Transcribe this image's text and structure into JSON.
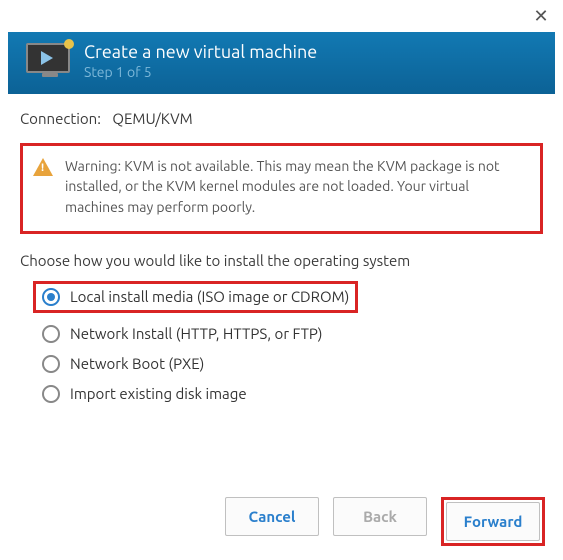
{
  "header": {
    "title": "Create a new virtual machine",
    "step": "Step 1 of 5"
  },
  "connection": {
    "label": "Connection:",
    "value": "QEMU/KVM"
  },
  "warning": {
    "text": "Warning: KVM is not available. This may mean the KVM package is not installed, or the KVM kernel modules are not loaded. Your virtual machines may perform poorly."
  },
  "choose_label": "Choose how you would like to install the operating system",
  "options": [
    {
      "label": "Local install media (ISO image or CDROM)",
      "selected": true,
      "highlighted": true
    },
    {
      "label": "Network Install (HTTP, HTTPS, or FTP)",
      "selected": false,
      "highlighted": false
    },
    {
      "label": "Network Boot (PXE)",
      "selected": false,
      "highlighted": false
    },
    {
      "label": "Import existing disk image",
      "selected": false,
      "highlighted": false
    }
  ],
  "buttons": {
    "cancel": "Cancel",
    "back": "Back",
    "forward": "Forward"
  }
}
